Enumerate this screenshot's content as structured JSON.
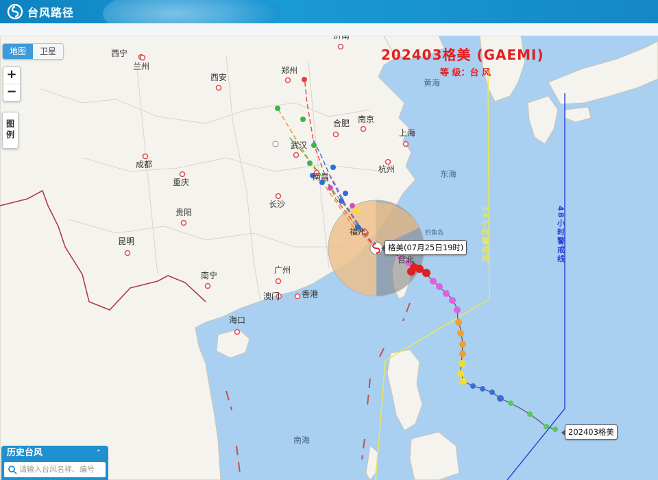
{
  "header": {
    "logo_text": "台风路径",
    "logo_icon": "typhoon-logo-icon"
  },
  "map_mode": {
    "map_label": "地图",
    "satellite_label": "卫星",
    "active": "地图"
  },
  "zoom": {
    "in_label": "+",
    "out_label": "−"
  },
  "legend_button": {
    "label": "图例"
  },
  "typhoon": {
    "title": "202403格美 (GAEMI)",
    "grade_text": "等 级：台 风",
    "current_tip": "格美(07月25日19时)",
    "start_tip": "202403格美"
  },
  "history_panel": {
    "title": "历史台风",
    "caret": "⌃",
    "search_placeholder": "请输入台风名称、编号",
    "search_value": ""
  },
  "warning_lines": {
    "line24_text": "24小时警戒线",
    "line48_text": "48小时警戒线",
    "line24_color": "#e6e85a",
    "line48_color": "#2a3fd6"
  },
  "cities": [
    {
      "name": "西宁"
    },
    {
      "name": "兰州"
    },
    {
      "name": "西安"
    },
    {
      "name": "郑州"
    },
    {
      "name": "济南"
    },
    {
      "name": "合肥"
    },
    {
      "name": "南京"
    },
    {
      "name": "上海"
    },
    {
      "name": "武汉"
    },
    {
      "name": "杭州"
    },
    {
      "name": "成都"
    },
    {
      "name": "重庆"
    },
    {
      "name": "南昌"
    },
    {
      "name": "长沙"
    },
    {
      "name": "福州"
    },
    {
      "name": "贵阳"
    },
    {
      "name": "昆明"
    },
    {
      "name": "台北"
    },
    {
      "name": "广州"
    },
    {
      "name": "南宁"
    },
    {
      "name": "澳门"
    },
    {
      "name": "香港"
    },
    {
      "name": "海口"
    }
  ],
  "seas": [
    {
      "name": "黄海"
    },
    {
      "name": "东海"
    },
    {
      "name": "南海"
    },
    {
      "name": "钓鱼岛"
    }
  ],
  "colors": {
    "sea": "#a9cff1",
    "land": "#f5f3ed",
    "border_red": "#b03b46",
    "title_red": "#e02020",
    "header_blue": "#1587c7"
  }
}
